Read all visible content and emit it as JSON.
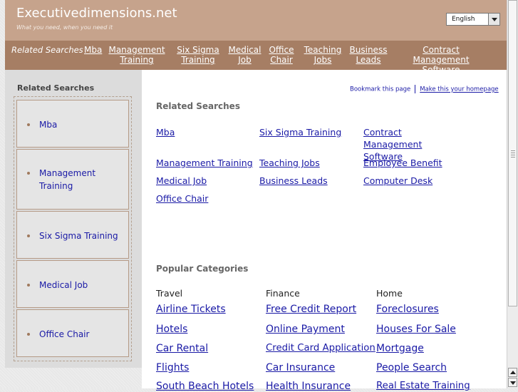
{
  "header": {
    "title": "Executivedimensions.net",
    "tagline": "What you need, when you need it",
    "language": "English"
  },
  "nav": {
    "label": "Related Searches",
    "links": [
      "Mba",
      "Management Training",
      "Six Sigma Training",
      "Medical Job",
      "Office Chair",
      "Teaching Jobs",
      "Business Leads",
      "Contract Management Software"
    ]
  },
  "sidebar": {
    "title": "Related Searches",
    "items": [
      "Mba",
      "Management Training",
      "Six Sigma Training",
      "Medical Job",
      "Office Chair"
    ]
  },
  "main": {
    "bookmark": "Bookmark this page",
    "homepage": "Make this your homepage",
    "related_title": "Related Searches",
    "related": [
      "Mba",
      "Six Sigma Training",
      "Contract Management Software",
      "Management Training",
      "Teaching Jobs",
      "Employee Benefit",
      "Medical Job",
      "Business Leads",
      "Computer Desk",
      "Office Chair"
    ],
    "popular_title": "Popular Categories",
    "categories": [
      {
        "name": "Travel",
        "links": [
          "Airline Tickets",
          "Hotels",
          "Car Rental",
          "Flights",
          "South Beach Hotels"
        ]
      },
      {
        "name": "Finance",
        "links": [
          "Free Credit Report",
          "Online Payment",
          "Credit Card Application",
          "Car Insurance",
          "Health Insurance"
        ]
      },
      {
        "name": "Home",
        "links": [
          "Foreclosures",
          "Houses For Sale",
          "Mortgage",
          "People Search",
          "Real Estate Training"
        ]
      }
    ]
  }
}
